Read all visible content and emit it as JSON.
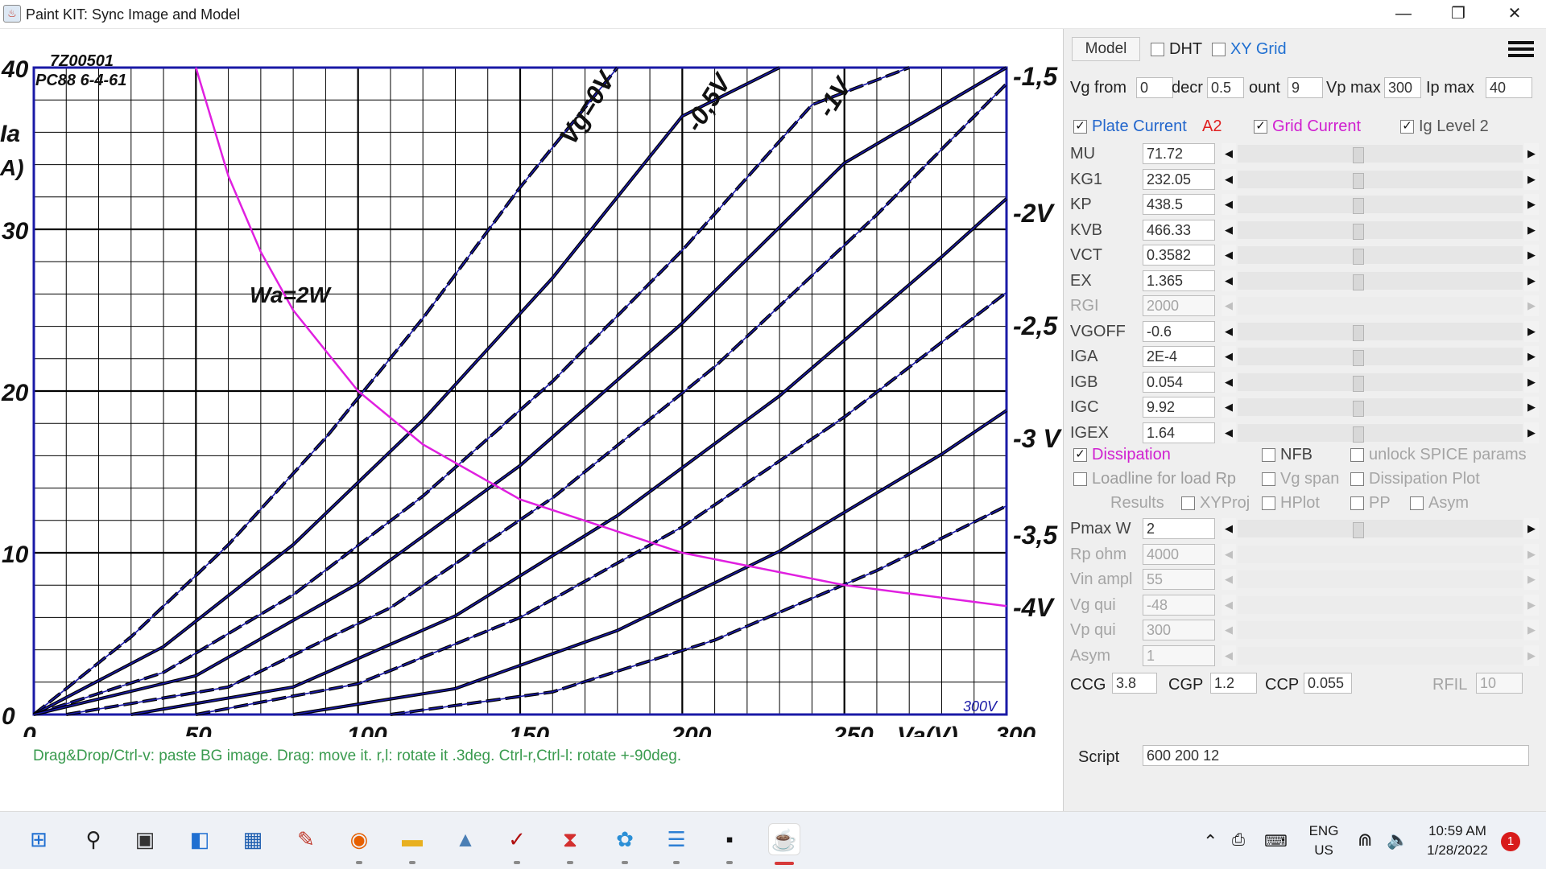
{
  "window": {
    "title": "Paint KIT: Sync Image and Model",
    "minimize": "—",
    "maximize": "❐",
    "close": "✕"
  },
  "chart_image": {
    "code": "7Z00501",
    "tube": "PC88  6-4-61",
    "ylabel": "Ia",
    "yunit": "A)",
    "xlabel": "Va(V)",
    "dissipation_label": "Wa=2W",
    "scale_label": "300V",
    "x_ticks": [
      "0",
      "50",
      "100",
      "150",
      "200",
      "250",
      "300"
    ],
    "y_ticks": [
      "0",
      "10",
      "20",
      "30",
      "40"
    ],
    "curve_labels": [
      "Vg=0V",
      "-0,5V",
      "-1V",
      "-1,5 V",
      "-2V",
      "-2,5",
      "-3 V",
      "-3,5",
      "-4V"
    ]
  },
  "chart_data": {
    "type": "line",
    "title": "",
    "xlabel": "Va(V)",
    "ylabel": "Ia",
    "xlim": [
      0,
      300
    ],
    "ylim": [
      0,
      40
    ],
    "grid": true,
    "series": [
      {
        "name": "Vg=0V",
        "x": [
          0,
          30,
          60,
          90,
          120,
          150,
          180
        ],
        "y": [
          0,
          4.8,
          10.5,
          17.1,
          24.5,
          32.6,
          41.3
        ]
      },
      {
        "name": "-0,5V",
        "x": [
          0,
          40,
          80,
          120,
          160,
          200,
          230
        ],
        "y": [
          0,
          4.2,
          10.5,
          18.2,
          27,
          37,
          44.9
        ]
      },
      {
        "name": "-1V",
        "x": [
          0,
          40,
          80,
          120,
          160,
          200,
          240,
          270
        ],
        "y": [
          0,
          2.6,
          7.4,
          13.5,
          20.6,
          28.7,
          37.7,
          44.9
        ]
      },
      {
        "name": "-1,5 V",
        "x": [
          0,
          50,
          100,
          150,
          200,
          250,
          300
        ],
        "y": [
          0,
          2.4,
          8.1,
          15.4,
          24.2,
          34.1,
          45
        ]
      },
      {
        "name": "-2V",
        "x": [
          10,
          60,
          110,
          160,
          210,
          260,
          300
        ],
        "y": [
          0,
          1.7,
          6.6,
          13.4,
          21.5,
          30.9,
          39
        ]
      },
      {
        "name": "-2,5",
        "x": [
          30,
          80,
          130,
          180,
          230,
          280,
          300
        ],
        "y": [
          0,
          1.7,
          6.1,
          12.3,
          19.7,
          28.3,
          31.9
        ]
      },
      {
        "name": "-3 V",
        "x": [
          50,
          100,
          150,
          200,
          250,
          300
        ],
        "y": [
          0,
          1.9,
          6,
          11.6,
          18.4,
          26.1
        ]
      },
      {
        "name": "-3,5",
        "x": [
          80,
          130,
          180,
          230,
          280,
          300
        ],
        "y": [
          0,
          1.6,
          5.2,
          10.1,
          16.1,
          18.8
        ]
      },
      {
        "name": "-4V",
        "x": [
          110,
          160,
          210,
          260,
          300
        ],
        "y": [
          0,
          1.4,
          4.6,
          8.9,
          12.9
        ]
      },
      {
        "name": "Wa=2W",
        "x": [
          50,
          60,
          70,
          80,
          100,
          120,
          150,
          200,
          250,
          300
        ],
        "y": [
          40,
          33.3,
          28.6,
          25,
          20,
          16.7,
          13.3,
          10,
          8,
          6.7
        ]
      }
    ]
  },
  "hint": "Drag&Drop/Ctrl-v: paste BG image. Drag: move it. r,l: rotate it .3deg. Ctrl-r,Ctrl-l: rotate +-90deg.",
  "panel": {
    "model_button": "Model",
    "dht_label": "DHT",
    "xygrid_label": "XY Grid",
    "menu": "menu",
    "row2": {
      "vg_from_label": "Vg from",
      "vg_from_value": "0",
      "decr_label": "decr",
      "decr_value": "0.5",
      "count_label": "ount",
      "count_value": "9",
      "vp_max_label": "Vp max",
      "vp_max_value": "300",
      "ip_max_label": "Ip max",
      "ip_max_value": "40"
    },
    "plate_current_label": "Plate Current",
    "a2_label": "A2",
    "grid_current_label": "Grid Current",
    "ig_level_label": "Ig Level 2",
    "params": [
      {
        "name": "MU",
        "value": "71.72",
        "enabled": true
      },
      {
        "name": "KG1",
        "value": "232.05",
        "enabled": true
      },
      {
        "name": "KP",
        "value": "438.5",
        "enabled": true
      },
      {
        "name": "KVB",
        "value": "466.33",
        "enabled": true
      },
      {
        "name": "VCT",
        "value": "0.3582",
        "enabled": true
      },
      {
        "name": "EX",
        "value": "1.365",
        "enabled": true
      },
      {
        "name": "RGI",
        "value": "2000",
        "enabled": false
      },
      {
        "name": "VGOFF",
        "value": "-0.6",
        "enabled": true
      },
      {
        "name": "IGA",
        "value": "2E-4",
        "enabled": true
      },
      {
        "name": "IGB",
        "value": "0.054",
        "enabled": true
      },
      {
        "name": "IGC",
        "value": "9.92",
        "enabled": true
      },
      {
        "name": "IGEX",
        "value": "1.64",
        "enabled": true
      }
    ],
    "dissipation_label": "Dissipation",
    "nfb_label": "NFB",
    "unlock_spice_label": "unlock SPICE params",
    "loadline_label": "Loadline for load Rp",
    "vg_span_label": "Vg span",
    "dissipation_plot_label": "Dissipation Plot",
    "results_label": "Results",
    "xyproj_label": "XYProj",
    "hplot_label": "HPlot",
    "pp_label": "PP",
    "asym_label": "Asym",
    "params2": [
      {
        "name": "Pmax W",
        "value": "2",
        "enabled": true
      },
      {
        "name": "Rp ohm",
        "value": "4000",
        "enabled": false
      },
      {
        "name": "Vin ampl",
        "value": "55",
        "enabled": false
      },
      {
        "name": "Vg qui",
        "value": "-48",
        "enabled": false
      },
      {
        "name": "Vp qui",
        "value": "300",
        "enabled": false
      },
      {
        "name": "Asym",
        "value": "1",
        "enabled": false
      }
    ],
    "ccg_label": "CCG",
    "ccg_value": "3.8",
    "cgp_label": "CGP",
    "cgp_value": "1.2",
    "ccp_label": "CCP",
    "ccp_value": "0.055",
    "rfil_label": "RFIL",
    "rfil_value": "10",
    "script_label": "Script",
    "script_value": "600 200 12"
  },
  "taskbar": {
    "icons": [
      {
        "name": "start-icon",
        "glyph": "⊞",
        "color": "#1f6fd1"
      },
      {
        "name": "search-icon",
        "glyph": "⚲",
        "color": "#222222"
      },
      {
        "name": "task-view-icon",
        "glyph": "▣",
        "color": "#333333"
      },
      {
        "name": "widgets-icon",
        "glyph": "◧",
        "color": "#1f6fd1"
      },
      {
        "name": "store-icon",
        "glyph": "▦",
        "color": "#1f5fb0"
      },
      {
        "name": "notepad-app-icon",
        "glyph": "✎",
        "color": "#c0392b"
      },
      {
        "name": "firefox-icon",
        "glyph": "◉",
        "color": "#e66000"
      },
      {
        "name": "file-explorer-icon",
        "glyph": "▬",
        "color": "#e8b020"
      },
      {
        "name": "drive-icon",
        "glyph": "▲",
        "color": "#4a7fb5"
      },
      {
        "name": "studio-app-icon",
        "glyph": "✓",
        "color": "#b01010"
      },
      {
        "name": "acrobat-icon",
        "glyph": "⧗",
        "color": "#d32f2f"
      },
      {
        "name": "paint-app-icon",
        "glyph": "✿",
        "color": "#2b8fd6"
      },
      {
        "name": "notes-app-icon",
        "glyph": "☰",
        "color": "#2d7fd4"
      },
      {
        "name": "terminal-icon",
        "glyph": "▪",
        "color": "#111111"
      },
      {
        "name": "java-app-icon",
        "glyph": "☕",
        "color": "#d0502a"
      }
    ],
    "lang_top": "ENG",
    "lang_bottom": "US",
    "time": "10:59 AM",
    "date": "1/28/2022",
    "notifications": "1"
  },
  "colors": {
    "plot_blue": "#1a1aa6",
    "plot_magenta": "#e020e0",
    "hint_green": "#3a9b4f",
    "accent_blue": "#1f6fd1",
    "plate_current_blue": "#2266cc",
    "a2_red": "#e02020",
    "grid_current_magenta": "#d020d0"
  }
}
